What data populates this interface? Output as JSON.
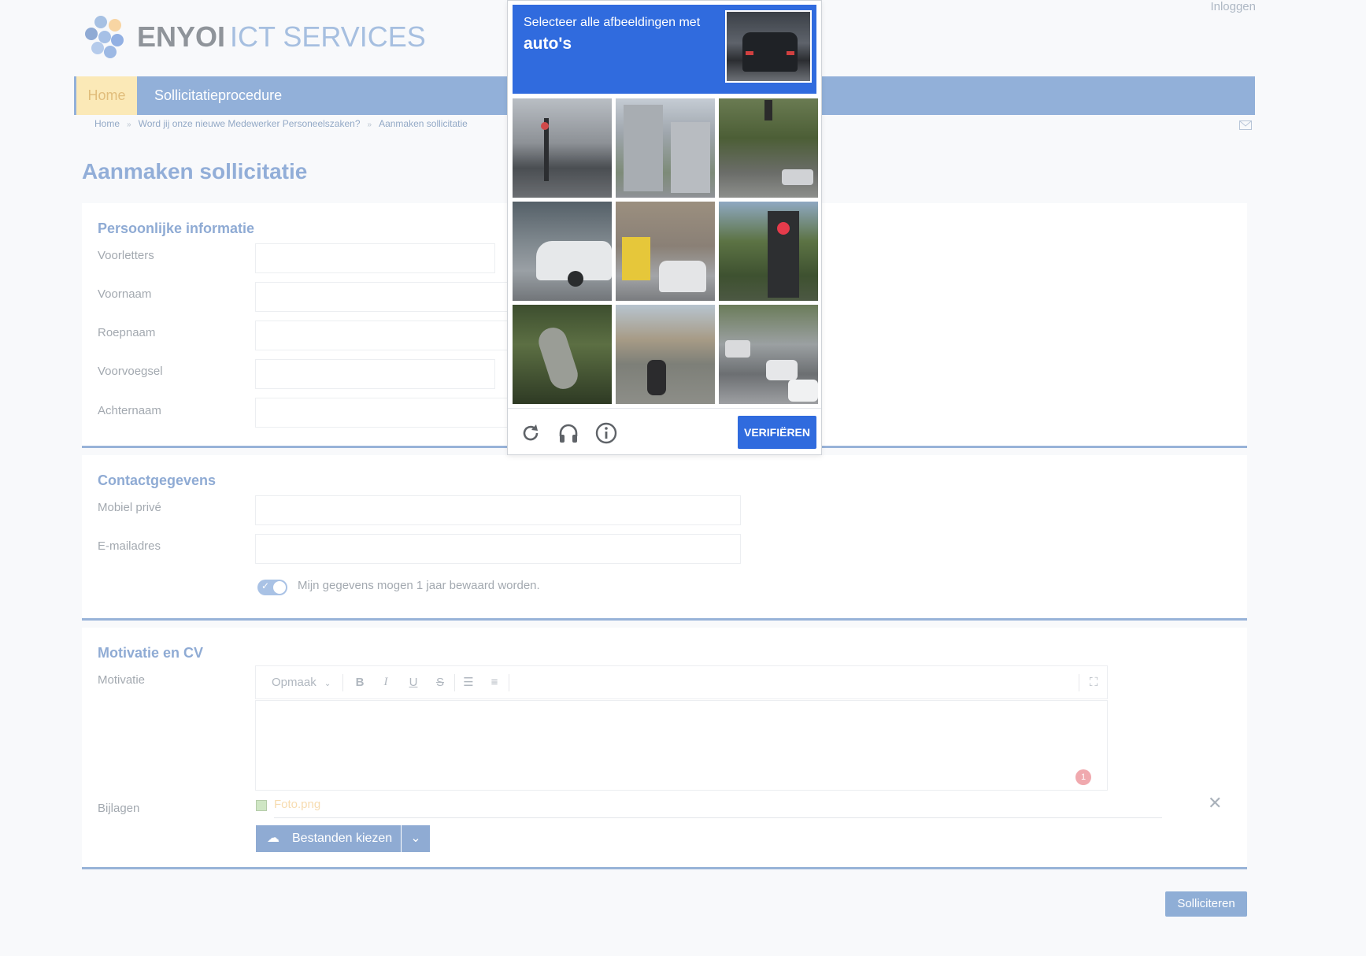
{
  "header": {
    "brand_bold": "ENYOI",
    "brand_light": "ICT SERVICES",
    "login": "Inloggen"
  },
  "nav": {
    "home": "Home",
    "procedure": "Sollicitatieprocedure"
  },
  "breadcrumb": {
    "items": [
      "Home",
      "Word jij onze nieuwe Medewerker Personeelszaken?",
      "Aanmaken sollicitatie"
    ],
    "separator": "»"
  },
  "page": {
    "title": "Aanmaken sollicitatie"
  },
  "personal": {
    "title": "Persoonlijke informatie",
    "fields": [
      {
        "label": "Voorletters",
        "value": ""
      },
      {
        "label": "Voornaam",
        "value": ""
      },
      {
        "label": "Roepnaam",
        "value": ""
      },
      {
        "label": "Voorvoegsel",
        "value": ""
      },
      {
        "label": "Achternaam",
        "value": ""
      }
    ]
  },
  "contact": {
    "title": "Contactgegevens",
    "fields": [
      {
        "label": "Mobiel privé",
        "value": ""
      },
      {
        "label": "E-mailadres",
        "value": ""
      }
    ],
    "consent": "Mijn gegevens mogen 1 jaar bewaard worden.",
    "consent_on": true
  },
  "motivation": {
    "title": "Motivatie en CV",
    "motivation_label": "Motivatie",
    "format_select": "Opmaak",
    "error_count": "1",
    "attachments_label": "Bijlagen",
    "attachment_file": "Foto.png",
    "upload_button": "Bestanden kiezen"
  },
  "submit": "Solliciteren",
  "captcha": {
    "instruction": "Selecteer alle afbeeldingen met",
    "target": "auto's",
    "verify": "VERIFIËREN",
    "icons": [
      "reload-icon",
      "audio-icon",
      "info-icon"
    ]
  },
  "colors": {
    "accent": "#92b0d9",
    "captcha_blue": "#306bde",
    "home_tab": "#fbe9b7"
  }
}
